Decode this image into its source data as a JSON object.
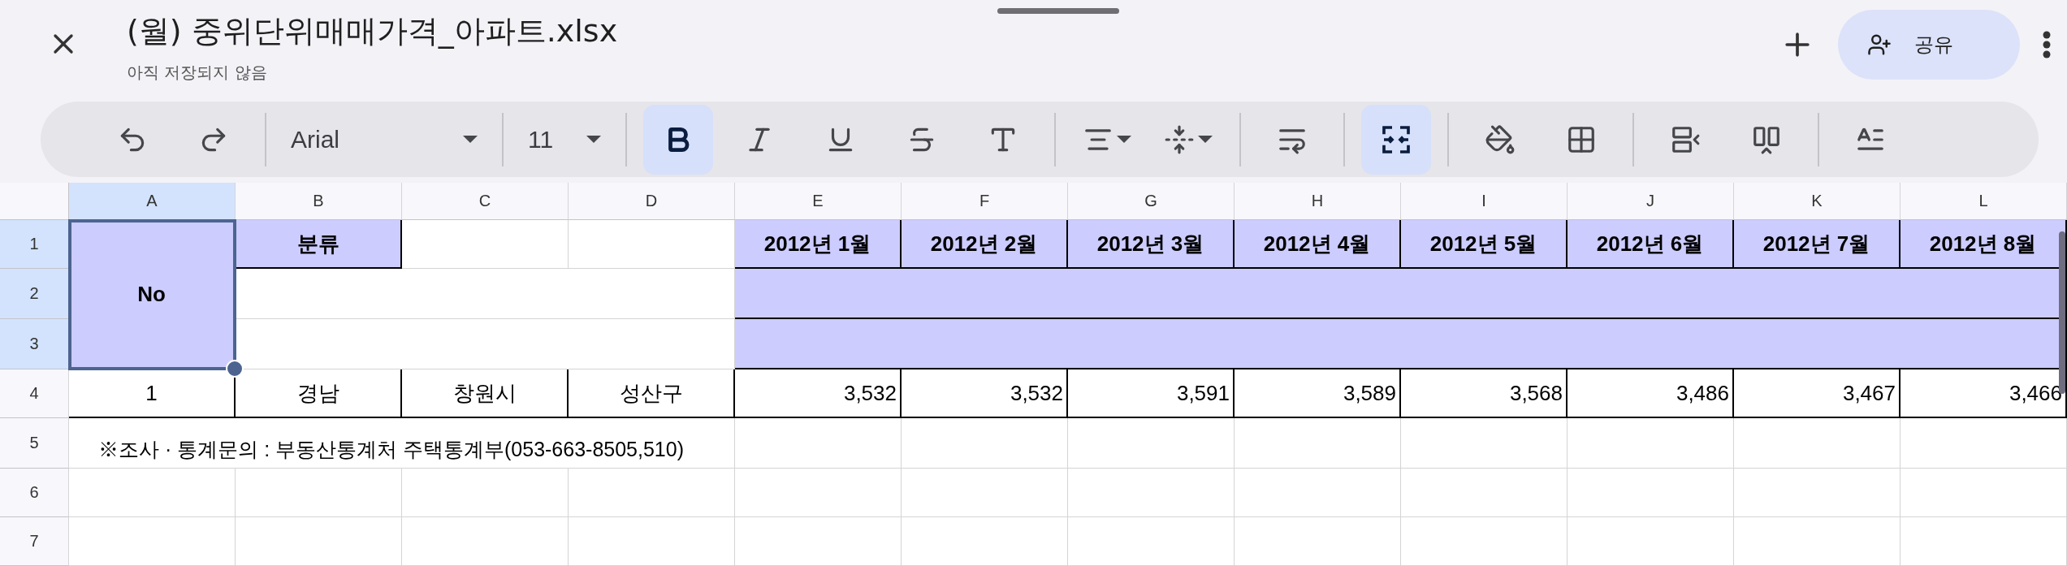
{
  "document": {
    "title": "(월) 중위단위매매가격_아파트.xlsx",
    "status": "아직 저장되지 않음"
  },
  "share": {
    "label": "공유"
  },
  "toolbar": {
    "font": "Arial",
    "font_size": "11",
    "groups": [
      [
        {
          "kind": "undo",
          "on": false
        },
        {
          "kind": "redo",
          "on": false
        }
      ],
      [
        {
          "kind": "font"
        }
      ],
      [
        {
          "kind": "size"
        }
      ],
      [
        {
          "kind": "bold",
          "on": true
        },
        {
          "kind": "italic",
          "on": false
        },
        {
          "kind": "underline",
          "on": false
        },
        {
          "kind": "strike",
          "on": false
        },
        {
          "kind": "color",
          "on": false
        }
      ],
      [
        {
          "kind": "align",
          "on": false
        },
        {
          "kind": "valign",
          "on": false
        }
      ],
      [
        {
          "kind": "wrap",
          "on": false
        }
      ],
      [
        {
          "kind": "merge",
          "on": true
        }
      ],
      [
        {
          "kind": "fill",
          "on": false
        },
        {
          "kind": "borders",
          "on": false
        }
      ],
      [
        {
          "kind": "insert_row",
          "on": false
        },
        {
          "kind": "insert_column",
          "on": false
        }
      ],
      [
        {
          "kind": "text_format",
          "on": false
        }
      ]
    ]
  },
  "sheet": {
    "columns": [
      {
        "label": "A",
        "selected": true
      },
      {
        "label": "B",
        "selected": false
      },
      {
        "label": "C",
        "selected": false
      },
      {
        "label": "D",
        "selected": false
      },
      {
        "label": "E",
        "selected": false
      },
      {
        "label": "F",
        "selected": false
      },
      {
        "label": "G",
        "selected": false
      },
      {
        "label": "H",
        "selected": false
      },
      {
        "label": "I",
        "selected": false
      },
      {
        "label": "J",
        "selected": false
      },
      {
        "label": "K",
        "selected": false
      },
      {
        "label": "L",
        "selected": false
      }
    ],
    "rows": [
      {
        "label": "1",
        "selected": true
      },
      {
        "label": "2",
        "selected": true
      },
      {
        "label": "3",
        "selected": true
      },
      {
        "label": "4",
        "selected": false
      },
      {
        "label": "5",
        "selected": false
      },
      {
        "label": "6",
        "selected": false
      },
      {
        "label": "7",
        "selected": false
      }
    ],
    "cells": [
      {
        "kind": "header",
        "text": "No",
        "selected": true
      },
      {
        "kind": "header",
        "text": "분류",
        "selected": false
      },
      {
        "kind": "header",
        "text": "2012년 1월",
        "selected": false
      },
      {
        "kind": "header",
        "text": "2012년 2월",
        "selected": false
      },
      {
        "kind": "header",
        "text": "2012년 3월",
        "selected": false
      },
      {
        "kind": "header",
        "text": "2012년 4월",
        "selected": false
      },
      {
        "kind": "header",
        "text": "2012년 5월",
        "selected": false
      },
      {
        "kind": "header",
        "text": "2012년 6월",
        "selected": false
      },
      {
        "kind": "header",
        "text": "2012년 7월",
        "selected": false
      },
      {
        "kind": "header",
        "text": "2012년 8월",
        "selected": false
      },
      {
        "kind": "blank",
        "selected": false
      },
      {
        "kind": "blank",
        "selected": false
      },
      {
        "kind": "header",
        "selected": false
      },
      {
        "kind": "header",
        "selected": false
      },
      {
        "kind": "text",
        "text": "1",
        "selected": false
      },
      {
        "kind": "text",
        "text": "경남",
        "selected": false
      },
      {
        "kind": "text",
        "text": "창원시",
        "selected": false
      },
      {
        "kind": "text",
        "text": "성산구",
        "selected": false
      },
      {
        "kind": "number",
        "text": "3,532",
        "selected": false
      },
      {
        "kind": "number",
        "text": "3,532",
        "selected": false
      },
      {
        "kind": "number",
        "text": "3,591",
        "selected": false
      },
      {
        "kind": "number",
        "text": "3,589",
        "selected": false
      },
      {
        "kind": "number",
        "text": "3,568",
        "selected": false
      },
      {
        "kind": "number",
        "text": "3,486",
        "selected": false
      },
      {
        "kind": "number",
        "text": "3,467",
        "selected": false
      },
      {
        "kind": "number",
        "text": "3,466",
        "selected": false
      },
      {
        "kind": "note",
        "text": "※조사 · 통계문의 : 부동산통계처 주택통계부(053-663-8505,510)",
        "selected": false
      }
    ]
  }
}
